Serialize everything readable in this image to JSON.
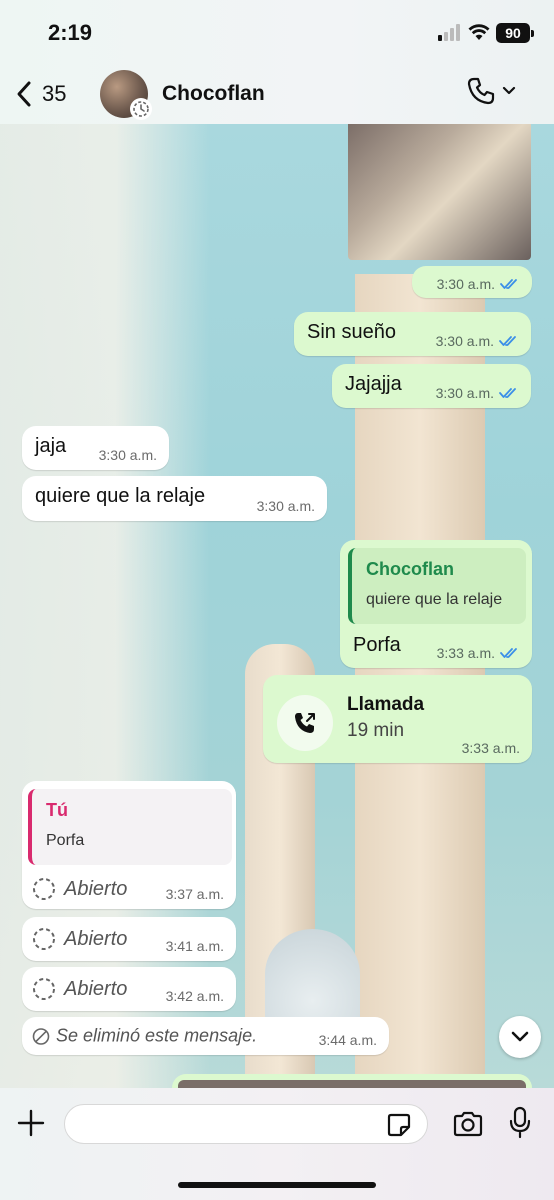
{
  "status": {
    "time": "2:19",
    "battery": "90"
  },
  "header": {
    "back_count": "35",
    "contact_name": "Chocoflan"
  },
  "messages": {
    "photo_time": "3:30 a.m.",
    "m1": {
      "text": "Sin sueño",
      "time": "3:30 a.m."
    },
    "m2": {
      "text": "Jajajja",
      "time": "3:30 a.m."
    },
    "m3": {
      "text": "jaja",
      "time": "3:30 a.m."
    },
    "m4": {
      "text": "quiere que la relaje",
      "time": "3:30 a.m."
    },
    "m5": {
      "quote_author": "Chocoflan",
      "quote_text": "quiere que la relaje",
      "text": "Porfa",
      "time": "3:33 a.m."
    },
    "call": {
      "title": "Llamada",
      "duration": "19 min",
      "time": "3:33 a.m."
    },
    "m6": {
      "quote_author": "Tú",
      "quote_text": "Porfa",
      "label": "Abierto",
      "time": "3:37 a.m."
    },
    "m7": {
      "label": "Abierto",
      "time": "3:41 a.m."
    },
    "m8": {
      "label": "Abierto",
      "time": "3:42 a.m."
    },
    "deleted": {
      "text": "Se eliminó este mensaje.",
      "time": "3:44 a.m."
    }
  },
  "input": {
    "value": "",
    "placeholder": ""
  },
  "colors": {
    "outgoing_bubble": "#dcf9cf",
    "incoming_bubble": "#ffffff",
    "read_ticks": "#3b8fe8",
    "quote_green": "#1f8a4c",
    "quote_pink": "#d92a6e"
  },
  "icons": [
    "back-chevron-icon",
    "status-ring-icon",
    "phone-icon",
    "chevron-down-icon",
    "read-ticks-icon",
    "call-outgoing-icon",
    "view-once-icon",
    "deleted-icon",
    "plus-icon",
    "sticker-icon",
    "camera-icon",
    "mic-icon"
  ]
}
